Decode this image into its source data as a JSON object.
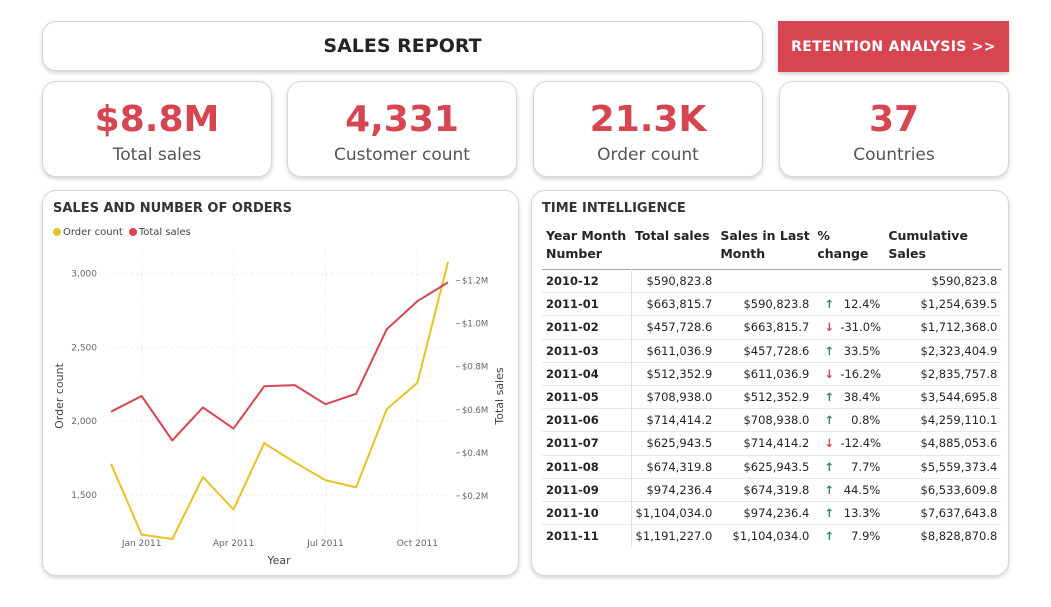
{
  "header": {
    "title": "SALES REPORT",
    "retention_button": "RETENTION ANALYSIS >>"
  },
  "kpis": [
    {
      "value": "$8.8M",
      "label": "Total sales"
    },
    {
      "value": "4,331",
      "label": "Customer count"
    },
    {
      "value": "21.3K",
      "label": "Order count"
    },
    {
      "value": "37",
      "label": "Countries"
    }
  ],
  "chart_panel": {
    "title": "SALES AND NUMBER OF ORDERS",
    "legend": [
      {
        "name": "Order count",
        "color": "#e6c229"
      },
      {
        "name": "Total sales",
        "color": "#d64550"
      }
    ]
  },
  "chart_data": {
    "type": "line",
    "xlabel": "Year",
    "ylabel_left": "Order count",
    "ylabel_right": "Total sales",
    "x_ticks": [
      "Jan 2011",
      "Apr 2011",
      "Jul 2011",
      "Oct 2011"
    ],
    "y_left_ticks": [
      "3,000",
      "2,500",
      "2,000",
      "1,500"
    ],
    "y_right_ticks": [
      "$1.2M",
      "$1.0M",
      "$0.8M",
      "$0.6M",
      "$0.4M",
      "$0.2M"
    ],
    "ylim_left": [
      1200,
      3100
    ],
    "ylim_right": [
      0,
      1300000
    ],
    "x": [
      "2010-12",
      "2011-01",
      "2011-02",
      "2011-03",
      "2011-04",
      "2011-05",
      "2011-06",
      "2011-07",
      "2011-08",
      "2011-09",
      "2011-10",
      "2011-11"
    ],
    "series": [
      {
        "name": "Order count",
        "axis": "left",
        "color": "#e6c229",
        "values": [
          1710,
          1230,
          1200,
          1620,
          1400,
          1850,
          1720,
          1600,
          1550,
          2080,
          2260,
          3080
        ]
      },
      {
        "name": "Total sales",
        "axis": "right",
        "color": "#d64550",
        "values": [
          590823.8,
          663815.7,
          457728.6,
          611036.9,
          512352.9,
          708938.0,
          714414.2,
          625943.5,
          674319.8,
          974236.4,
          1104034.0,
          1191227.0
        ]
      }
    ]
  },
  "table_panel": {
    "title": "TIME INTELLIGENCE",
    "columns": [
      "Year Month Number",
      "Total sales",
      "Sales in Last Month",
      "% change",
      "Cumulative Sales"
    ],
    "rows": [
      {
        "ym": "2010-12",
        "sales": "$590,823.8",
        "last": "",
        "dir": "",
        "pct": "",
        "cum": "$590,823.8"
      },
      {
        "ym": "2011-01",
        "sales": "$663,815.7",
        "last": "$590,823.8",
        "dir": "up",
        "pct": "12.4%",
        "cum": "$1,254,639.5"
      },
      {
        "ym": "2011-02",
        "sales": "$457,728.6",
        "last": "$663,815.7",
        "dir": "down",
        "pct": "-31.0%",
        "cum": "$1,712,368.0"
      },
      {
        "ym": "2011-03",
        "sales": "$611,036.9",
        "last": "$457,728.6",
        "dir": "up",
        "pct": "33.5%",
        "cum": "$2,323,404.9"
      },
      {
        "ym": "2011-04",
        "sales": "$512,352.9",
        "last": "$611,036.9",
        "dir": "down",
        "pct": "-16.2%",
        "cum": "$2,835,757.8"
      },
      {
        "ym": "2011-05",
        "sales": "$708,938.0",
        "last": "$512,352.9",
        "dir": "up",
        "pct": "38.4%",
        "cum": "$3,544,695.8"
      },
      {
        "ym": "2011-06",
        "sales": "$714,414.2",
        "last": "$708,938.0",
        "dir": "up",
        "pct": "0.8%",
        "cum": "$4,259,110.1"
      },
      {
        "ym": "2011-07",
        "sales": "$625,943.5",
        "last": "$714,414.2",
        "dir": "down",
        "pct": "-12.4%",
        "cum": "$4,885,053.6"
      },
      {
        "ym": "2011-08",
        "sales": "$674,319.8",
        "last": "$625,943.5",
        "dir": "up",
        "pct": "7.7%",
        "cum": "$5,559,373.4"
      },
      {
        "ym": "2011-09",
        "sales": "$974,236.4",
        "last": "$674,319.8",
        "dir": "up",
        "pct": "44.5%",
        "cum": "$6,533,609.8"
      },
      {
        "ym": "2011-10",
        "sales": "$1,104,034.0",
        "last": "$974,236.4",
        "dir": "up",
        "pct": "13.3%",
        "cum": "$7,637,643.8"
      },
      {
        "ym": "2011-11",
        "sales": "$1,191,227.0",
        "last": "$1,104,034.0",
        "dir": "up",
        "pct": "7.9%",
        "cum": "$8,828,870.8"
      }
    ]
  },
  "icons": {
    "up": "arrow-up-icon",
    "down": "arrow-down-icon"
  }
}
